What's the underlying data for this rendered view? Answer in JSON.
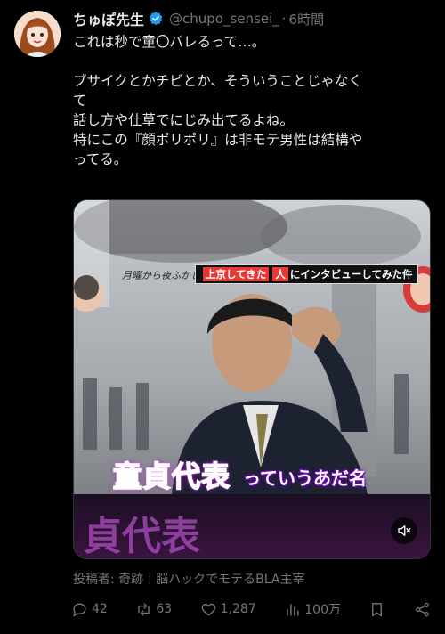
{
  "tweet": {
    "display_name": "ちゅぽ先生",
    "handle": "@chupo_sensei_",
    "separator": "·",
    "time": "6時間",
    "text_lines": [
      "これは秒で童〇バレるって…。",
      "",
      "ブサイクとかチビとか、そういうことじゃなく",
      "て",
      "話し方や仕草でにじみ出てるよね。",
      "特にこの『顔ポリポリ』は非モテ男性は結構や",
      "ってる。"
    ]
  },
  "media": {
    "banner_left": "月曜から夜ふかし",
    "banner_parts": [
      "上京してきた",
      "人",
      "にインタビューしてみた件"
    ],
    "caption_big": "童貞代表",
    "caption_small": "っていうあだ名"
  },
  "source_line": "投稿者: 奇跡｜脳ハックでモテるBLA主宰",
  "actions": {
    "replies": "42",
    "reposts": "63",
    "likes": "1,287",
    "views": "100万"
  },
  "colors": {
    "background": "#000000",
    "text": "#e7e9ea",
    "muted": "#71767b",
    "verified": "#1d9bf0"
  }
}
